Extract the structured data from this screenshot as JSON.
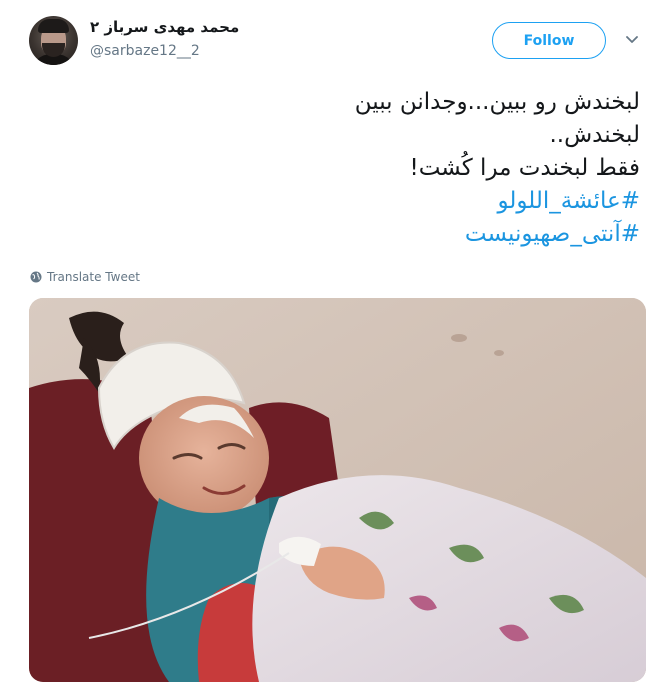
{
  "user": {
    "display_name": "محمد مهدی سرباز ۲",
    "handle": "@sarbaze12__2",
    "avatar_icon": "user-avatar-photo"
  },
  "actions": {
    "follow_label": "Follow",
    "menu_icon": "chevron-down-icon"
  },
  "tweet": {
    "lines": [
      "لبخندش رو ببین...وجدانن ببین",
      "لبخندش..",
      "فقط لبخندت مرا کُشت!"
    ],
    "hashtags": [
      "#عائشة_اللولو",
      "#آنتی_صهیونیست"
    ],
    "translate_label": "Translate Tweet"
  },
  "media": {
    "description_icon": "photo-girl-with-bandaged-head"
  },
  "colors": {
    "accent": "#1da1f2",
    "hashtag": "#1b95e0",
    "secondary_text": "#657786",
    "primary_text": "#14171a"
  }
}
